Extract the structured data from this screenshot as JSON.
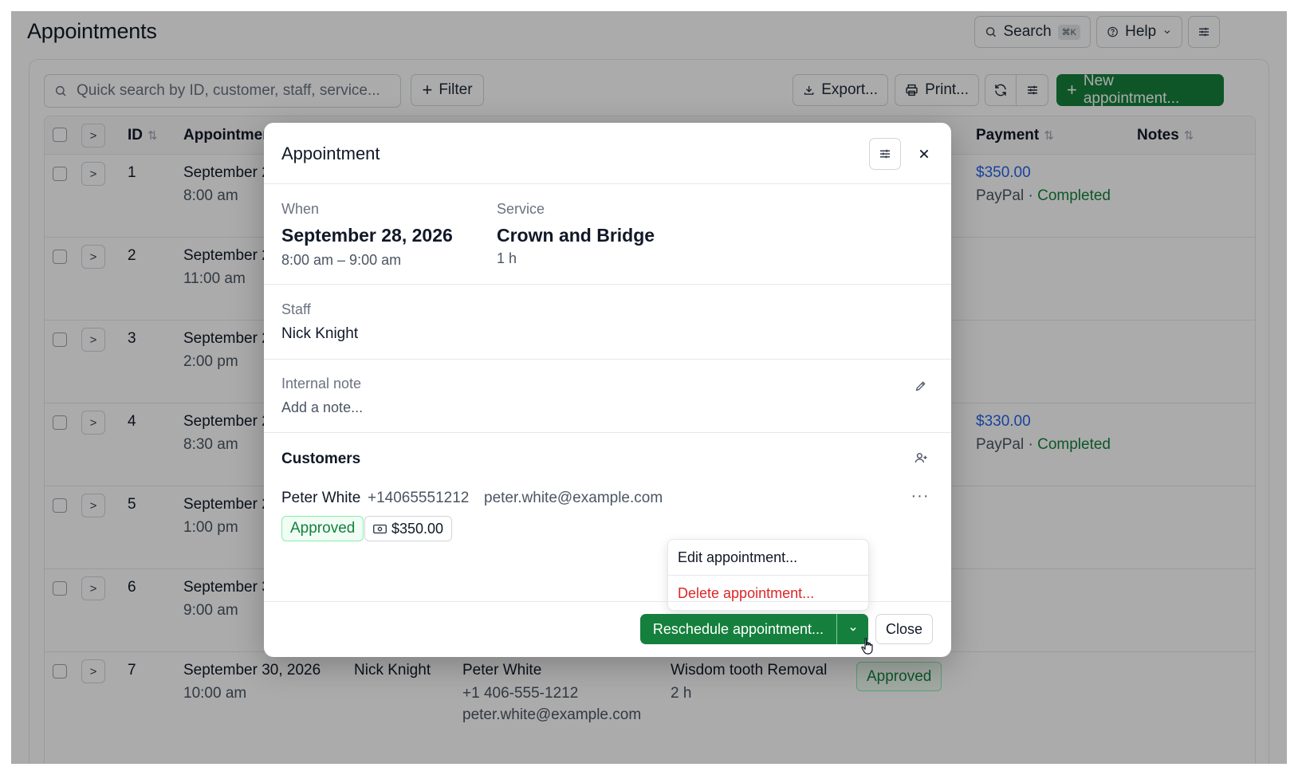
{
  "page": {
    "title": "Appointments"
  },
  "header": {
    "search_label": "Search",
    "search_shortcut": "⌘K",
    "help_label": "Help"
  },
  "toolbar": {
    "quick_search_placeholder": "Quick search by ID, customer, staff, service...",
    "filter_label": "Filter",
    "export_label": "Export...",
    "print_label": "Print...",
    "new_label": "New appointment..."
  },
  "table": {
    "headers": {
      "id": "ID",
      "appointment": "Appointmen",
      "payment": "Payment",
      "notes": "Notes"
    },
    "rows": [
      {
        "id": "1",
        "date": "September 2",
        "time": "8:00 am",
        "payment_amount": "$350.00",
        "payment_method": "PayPal · ",
        "payment_status": "Completed"
      },
      {
        "id": "2",
        "date": "September 2",
        "time": "11:00 am",
        "payment_amount": "",
        "payment_method": "",
        "payment_status": ""
      },
      {
        "id": "3",
        "date": "September 2",
        "time": "2:00 pm",
        "payment_amount": "",
        "payment_method": "",
        "payment_status": ""
      },
      {
        "id": "4",
        "date": "September 2",
        "time": "8:30 am",
        "payment_amount": "$330.00",
        "payment_method": "PayPal · ",
        "payment_status": "Completed"
      },
      {
        "id": "5",
        "date": "September 2",
        "time": "1:00 pm",
        "payment_amount": "",
        "payment_method": "",
        "payment_status": ""
      },
      {
        "id": "6",
        "date": "September 3",
        "time": "9:00 am",
        "payment_amount": "",
        "payment_method": "",
        "payment_status": ""
      },
      {
        "id": "7",
        "date": "September 30, 2026",
        "time": "10:00 am",
        "staff": "Nick Knight",
        "customer": "Peter White",
        "phone": "+1 406-555-1212",
        "email": "peter.white@example.com",
        "service": "Wisdom tooth Removal",
        "duration": "2 h",
        "status": "Approved"
      }
    ]
  },
  "modal": {
    "title": "Appointment",
    "when_label": "When",
    "date": "September 28, 2026",
    "time_range": "8:00 am – 9:00 am",
    "service_label": "Service",
    "service": "Crown and Bridge",
    "duration": "1 h",
    "staff_label": "Staff",
    "staff": "Nick Knight",
    "note_label": "Internal note",
    "note_placeholder": "Add a note...",
    "customers_label": "Customers",
    "customer": {
      "name": "Peter White",
      "phone": "+14065551212",
      "email": "peter.white@example.com",
      "status": "Approved",
      "amount": "$350.00"
    },
    "menu": {
      "edit": "Edit appointment...",
      "delete": "Delete appointment..."
    },
    "reschedule_label": "Reschedule appointment...",
    "close_label": "Close"
  },
  "colors": {
    "primary": "#15803d",
    "danger": "#dc2626",
    "link": "#2563eb",
    "overlay": "rgba(0,0,0,0.33)"
  }
}
